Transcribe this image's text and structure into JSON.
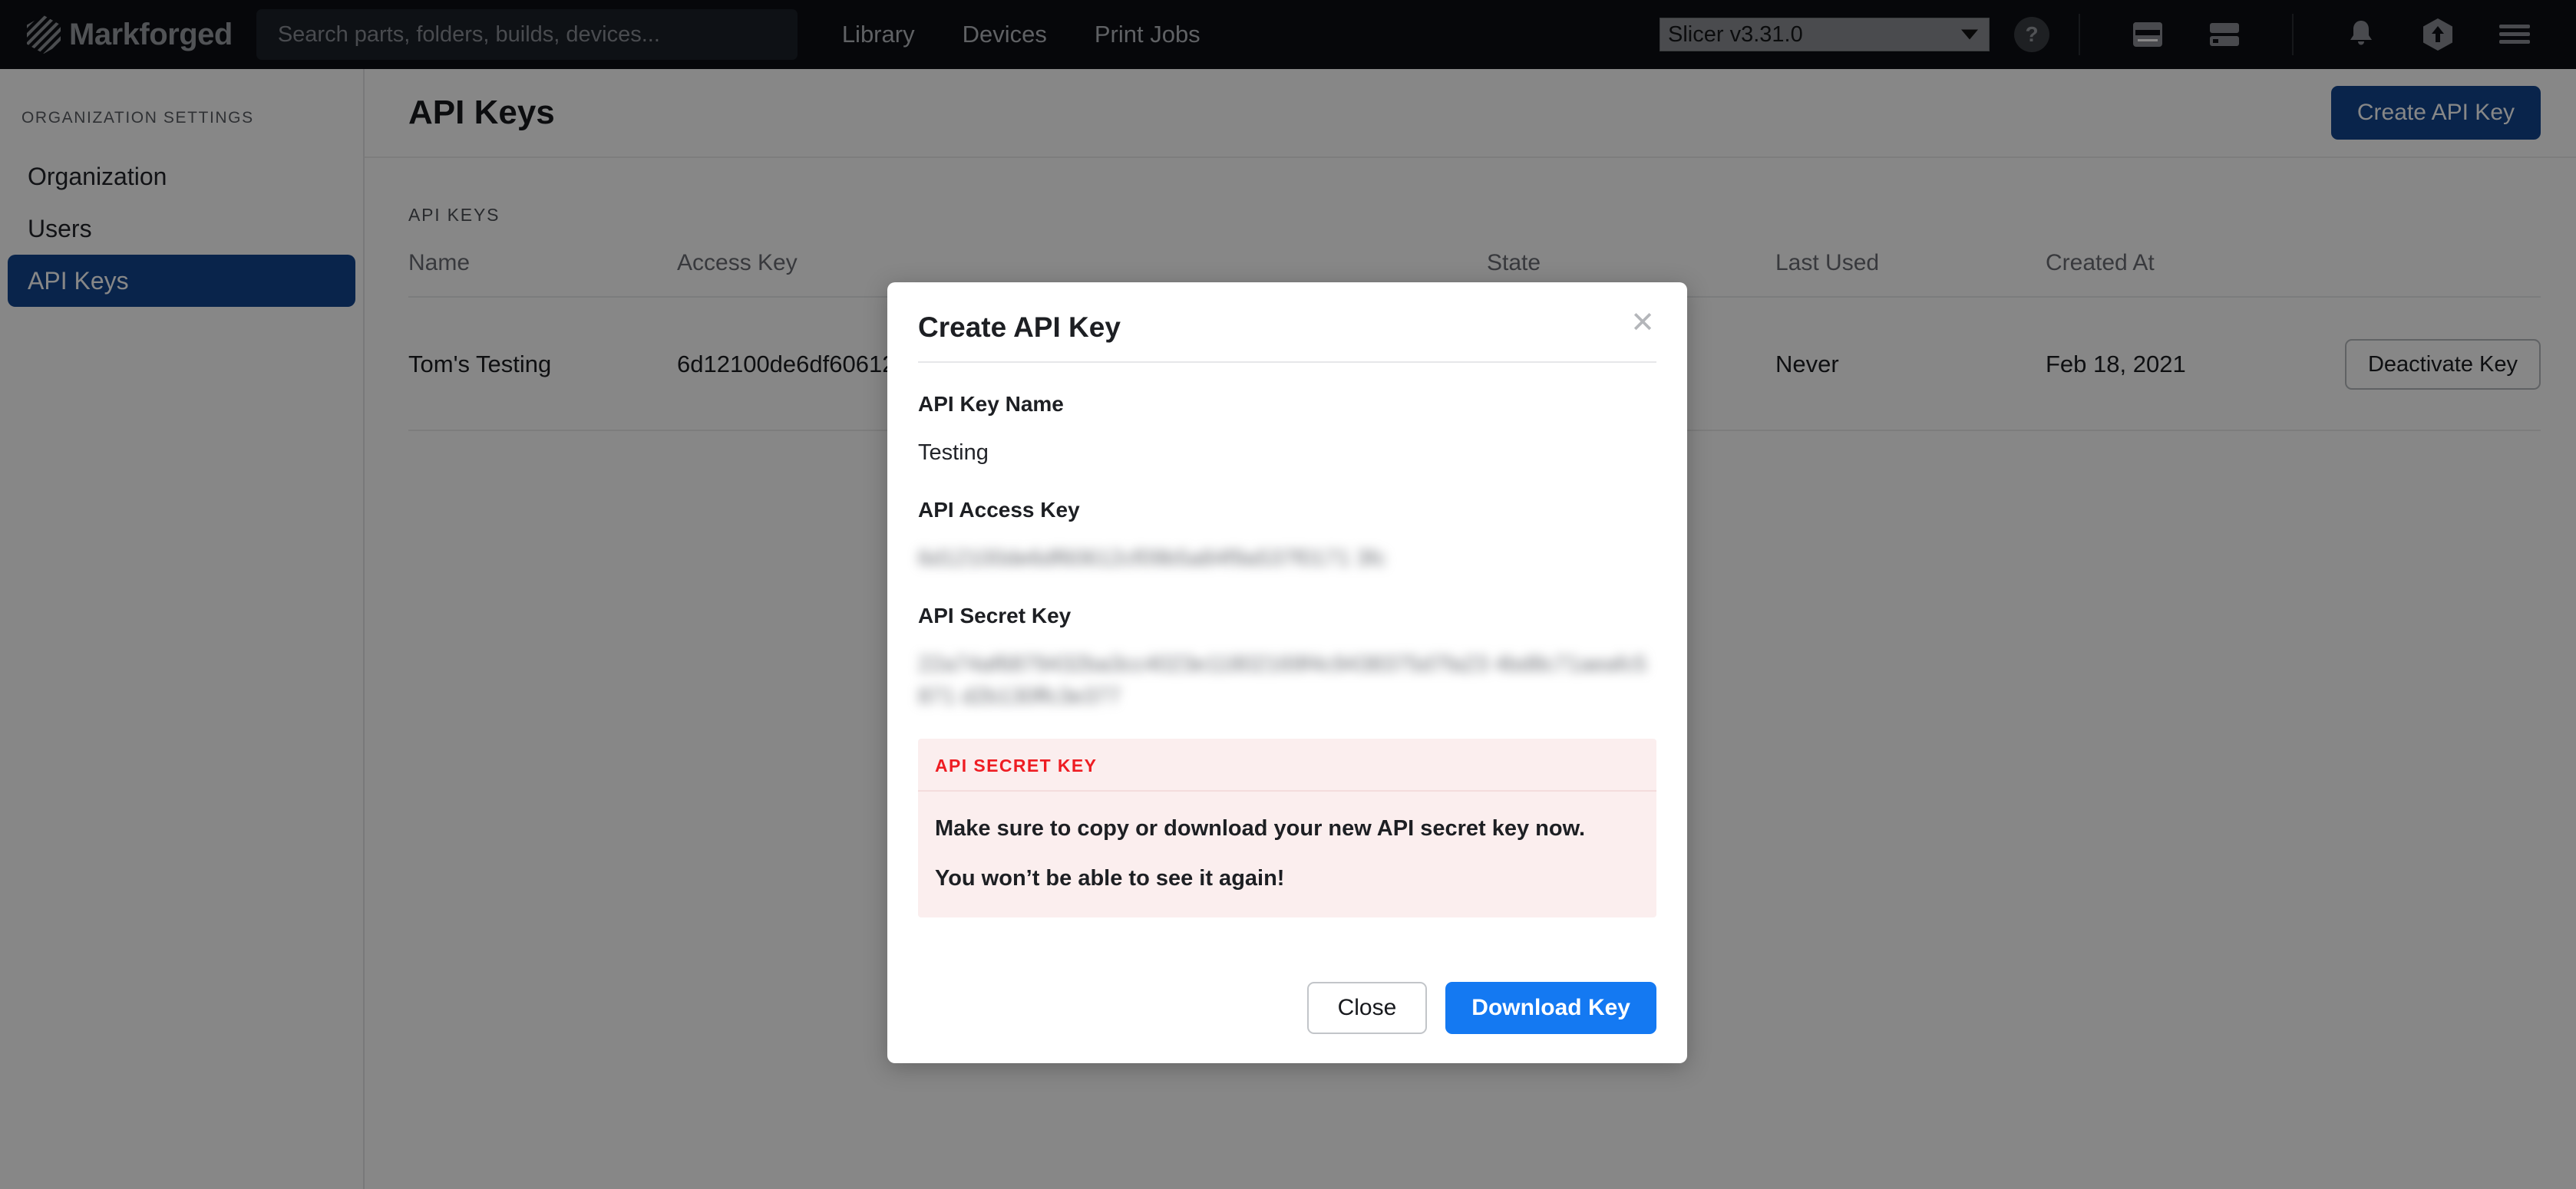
{
  "topnav": {
    "brand": "Markforged",
    "search": {
      "placeholder": "Search parts, folders, builds, devices...",
      "value": ""
    },
    "links": [
      {
        "label": "Library"
      },
      {
        "label": "Devices"
      },
      {
        "label": "Print Jobs"
      }
    ],
    "slicer_version": "Slicer v3.31.0",
    "help_label": "?",
    "icons": [
      {
        "name": "browser-window-icon"
      },
      {
        "name": "server-rack-icon"
      },
      {
        "name": "bell-icon"
      },
      {
        "name": "upload-hexagon-icon"
      },
      {
        "name": "hamburger-menu-icon"
      }
    ]
  },
  "sidebar": {
    "heading": "ORGANIZATION SETTINGS",
    "items": [
      {
        "label": "Organization",
        "active": false
      },
      {
        "label": "Users",
        "active": false
      },
      {
        "label": "API Keys",
        "active": true
      }
    ]
  },
  "page": {
    "title": "API Keys",
    "create_button": "Create API Key"
  },
  "table": {
    "caption": "API KEYS",
    "columns": [
      "Name",
      "Access Key",
      "State",
      "Last Used",
      "Created At",
      ""
    ],
    "rows": [
      {
        "name": "Tom's Testing",
        "access_key": "6d12100de6df60612",
        "state": "",
        "last_used": "Never",
        "created_at": "Feb 18, 2021",
        "action": "Deactivate Key"
      }
    ]
  },
  "modal": {
    "title": "Create API Key",
    "close_icon": "✕",
    "fields": [
      {
        "label": "API Key Name",
        "value": "Testing",
        "redacted": false
      },
      {
        "label": "API Access Key",
        "value": "6d12100de6df60612cf09b5a84f9a537f0171 3fc",
        "redacted": true
      },
      {
        "label": "API Secret Key",
        "value": "22a74af6879432ba3cc4023e11802169f4c9438375d7fa23 4bd8c71aeafc5871 d2b130ffc3e377",
        "redacted": true
      }
    ],
    "alert": {
      "heading": "API SECRET KEY",
      "line1": "Make sure to copy or download your new API secret key now.",
      "line2": "You won’t be able to see it again!",
      "accent_color": "#ee1d23",
      "background_color": "#fbeeee"
    },
    "close_button": "Close",
    "download_button": "Download Key"
  },
  "colors": {
    "topnav_bg": "#0d0f14",
    "sidebar_active": "#12458f",
    "primary_button": "#12458f",
    "download_button": "#1479f2"
  }
}
